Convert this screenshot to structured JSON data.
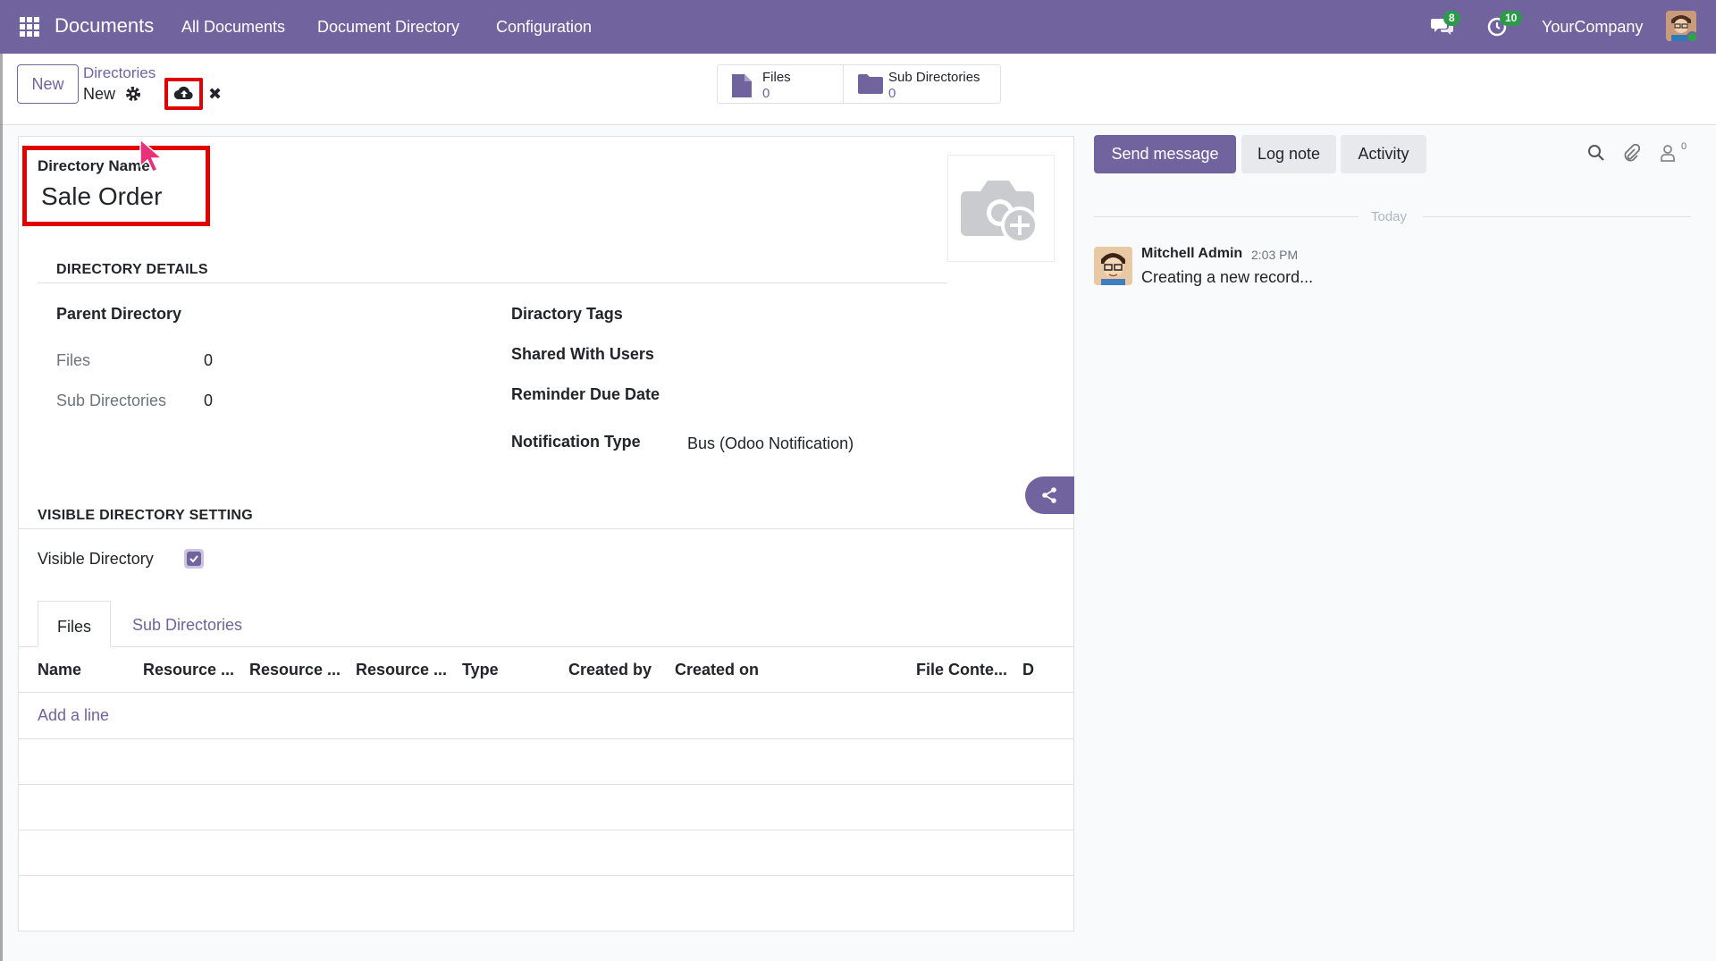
{
  "navbar": {
    "app_name": "Documents",
    "menu": [
      "All Documents",
      "Document Directory",
      "Configuration"
    ],
    "messages_badge": "8",
    "activities_badge": "10",
    "company": "YourCompany",
    "icons": [
      "apps-grid-icon",
      "chat-bubbles-icon",
      "clock-activity-icon",
      "user-avatar"
    ]
  },
  "control": {
    "new_label": "New",
    "breadcrumb_parent": "Directories",
    "breadcrumb_current": "New",
    "discard_symbol": "✖",
    "smart_buttons": [
      {
        "label": "Files",
        "value": "0",
        "icon": "file-icon"
      },
      {
        "label": "Sub Directories",
        "value": "0",
        "icon": "folder-icon"
      }
    ]
  },
  "form": {
    "name_label": "Directory Name",
    "name_value": "Sale Order",
    "details_title": "DIRECTORY DETAILS",
    "parent_directory_label": "Parent Directory",
    "files_label": "Files",
    "files_value": "0",
    "sub_directories_label": "Sub Directories",
    "sub_directories_value": "0",
    "tags_label": "Diractory Tags",
    "shared_label": "Shared With Users",
    "reminder_label": "Reminder Due Date",
    "notification_label": "Notification Type",
    "notification_value": "Bus (Odoo Notification)",
    "visible_title": "VISIBLE DIRECTORY SETTING",
    "visible_label": "Visible Directory",
    "visible_checked": true,
    "tabs": [
      "Files",
      "Sub Directories"
    ],
    "columns": [
      "Name",
      "Resource ...",
      "Resource ...",
      "Resource ...",
      "Type",
      "Created by",
      "Created on",
      "File Conte...",
      "D"
    ],
    "add_line": "Add a line"
  },
  "chatter": {
    "send_message": "Send message",
    "log_note": "Log note",
    "activity": "Activity",
    "followers_count": "0",
    "date_separator": "Today",
    "messages": [
      {
        "author": "Mitchell Admin",
        "time": "2:03 PM",
        "body": "Creating a new record..."
      }
    ]
  },
  "colors": {
    "brand": "#71639e",
    "highlight": "#e00000",
    "badge": "#2b9b4a"
  }
}
